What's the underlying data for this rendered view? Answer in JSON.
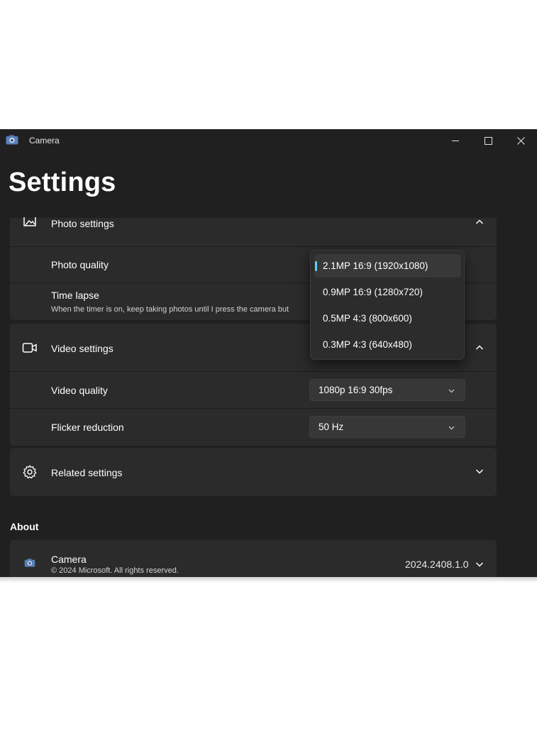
{
  "window": {
    "app_title": "Camera",
    "page_title": "Settings"
  },
  "photo_settings": {
    "header": "Photo settings",
    "photo_quality_label": "Photo quality",
    "time_lapse_label": "Time lapse",
    "time_lapse_description": "When the timer is on, keep taking photos until I press the camera but"
  },
  "photo_quality_dropdown": {
    "selected_index": 0,
    "options": [
      "2.1MP 16:9 (1920x1080)",
      "0.9MP 16:9 (1280x720)",
      "0.5MP 4:3 (800x600)",
      "0.3MP 4:3 (640x480)"
    ]
  },
  "video_settings": {
    "header": "Video settings",
    "video_quality_label": "Video quality",
    "video_quality_value": "1080p 16:9 30fps",
    "flicker_label": "Flicker reduction",
    "flicker_value": "50 Hz"
  },
  "related_settings": {
    "header": "Related settings"
  },
  "about": {
    "section_label": "About",
    "app_name": "Camera",
    "copyright": "© 2024 Microsoft. All rights reserved.",
    "version": "2024.2408.1.0"
  },
  "colors": {
    "window_bg": "#202020",
    "card_bg": "#2b2b2b",
    "accent": "#60cdff"
  },
  "icons": [
    "camera-app-icon",
    "minimize-icon",
    "maximize-icon",
    "close-icon",
    "photo-settings-icon",
    "chevron-up-icon",
    "video-camera-icon",
    "gear-icon",
    "chevron-down-icon"
  ]
}
